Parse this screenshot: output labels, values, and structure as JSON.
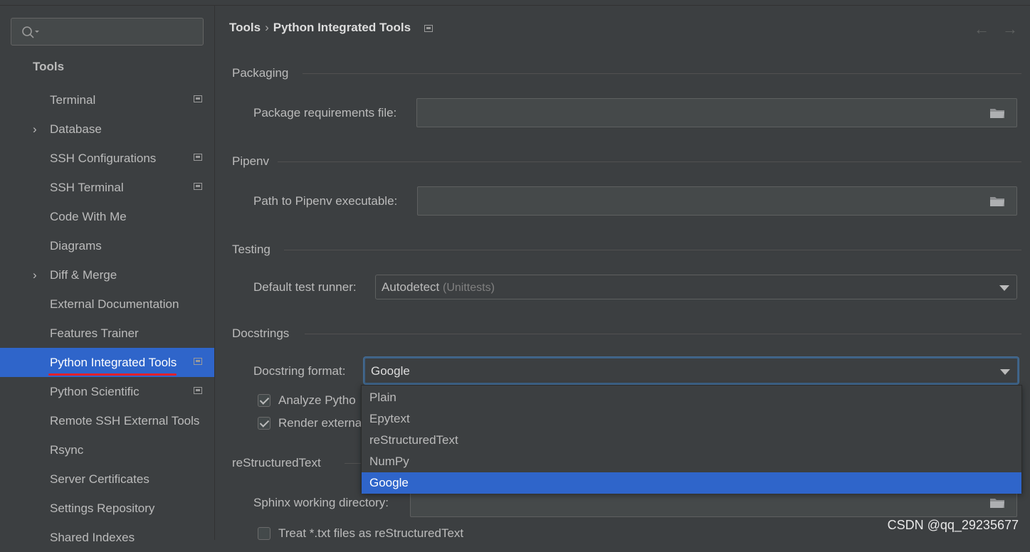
{
  "sidebar": {
    "search_placeholder": "",
    "root_label": "Tools",
    "items": [
      {
        "label": "Terminal"
      },
      {
        "label": "Database"
      },
      {
        "label": "SSH Configurations"
      },
      {
        "label": "SSH Terminal"
      },
      {
        "label": "Code With Me"
      },
      {
        "label": "Diagrams"
      },
      {
        "label": "Diff & Merge"
      },
      {
        "label": "External Documentation"
      },
      {
        "label": "Features Trainer"
      },
      {
        "label": "Python Integrated Tools"
      },
      {
        "label": "Python Scientific"
      },
      {
        "label": "Remote SSH External Tools"
      },
      {
        "label": "Rsync"
      },
      {
        "label": "Server Certificates"
      },
      {
        "label": "Settings Repository"
      },
      {
        "label": "Shared Indexes"
      }
    ]
  },
  "breadcrumb": {
    "parent": "Tools",
    "separator": "›",
    "current": "Python Integrated Tools"
  },
  "nav": {
    "back": "←",
    "forward": "→"
  },
  "packaging": {
    "title": "Packaging",
    "req_label": "Package requirements file:",
    "req_value": ""
  },
  "pipenv": {
    "title": "Pipenv",
    "path_label": "Path to Pipenv executable:",
    "path_value": ""
  },
  "testing": {
    "title": "Testing",
    "runner_label": "Default test runner:",
    "runner_value": "Autodetect",
    "runner_hint": "(Unittests)"
  },
  "docstrings": {
    "title": "Docstrings",
    "format_label": "Docstring format:",
    "format_value": "Google",
    "analyze_label": "Analyze Pytho",
    "render_label": "Render externa",
    "options": [
      "Plain",
      "Epytext",
      "reStructuredText",
      "NumPy",
      "Google"
    ],
    "selected_option": "Google"
  },
  "rst": {
    "title": "reStructuredText",
    "sphinx_label": "Sphinx working directory:",
    "sphinx_value": "",
    "treat_label": "Treat *.txt files as reStructuredText"
  },
  "watermark": "CSDN @qq_29235677"
}
